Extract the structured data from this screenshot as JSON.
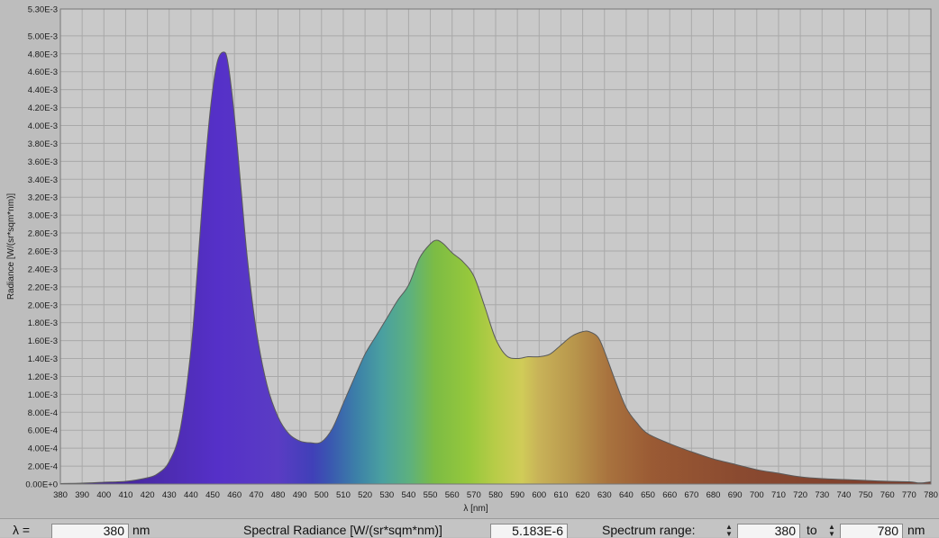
{
  "chart_data": {
    "type": "area",
    "xlabel": "λ [nm]",
    "ylabel": "Radiance [W/(sr*sqm*nm)]",
    "xlim": [
      380,
      780
    ],
    "ylim": [
      0,
      0.0053
    ],
    "grid": true,
    "x_ticks": [
      "380",
      "390",
      "400",
      "410",
      "420",
      "430",
      "440",
      "450",
      "460",
      "470",
      "480",
      "490",
      "500",
      "510",
      "520",
      "530",
      "540",
      "550",
      "560",
      "570",
      "580",
      "590",
      "600",
      "610",
      "620",
      "630",
      "640",
      "650",
      "660",
      "670",
      "680",
      "690",
      "700",
      "710",
      "720",
      "730",
      "740",
      "750",
      "760",
      "770",
      "780"
    ],
    "y_ticks": [
      "0.00E+0",
      "2.00E-4",
      "4.00E-4",
      "6.00E-4",
      "8.00E-4",
      "1.00E-3",
      "1.20E-3",
      "1.40E-3",
      "1.60E-3",
      "1.80E-3",
      "2.00E-3",
      "2.20E-3",
      "2.40E-3",
      "2.60E-3",
      "2.80E-3",
      "3.00E-3",
      "3.20E-3",
      "3.40E-3",
      "3.60E-3",
      "3.80E-3",
      "4.00E-3",
      "4.20E-3",
      "4.40E-3",
      "4.60E-3",
      "4.80E-3",
      "5.00E-3",
      "5.30E-3"
    ],
    "x": [
      380,
      390,
      400,
      410,
      420,
      425,
      430,
      435,
      440,
      443,
      446,
      449,
      452,
      455,
      457,
      460,
      463,
      466,
      470,
      475,
      480,
      485,
      490,
      495,
      500,
      505,
      510,
      515,
      520,
      525,
      530,
      535,
      540,
      545,
      550,
      553,
      556,
      560,
      565,
      570,
      575,
      580,
      585,
      590,
      595,
      600,
      605,
      610,
      615,
      620,
      623,
      627,
      630,
      635,
      640,
      645,
      650,
      660,
      670,
      680,
      690,
      700,
      710,
      720,
      730,
      740,
      750,
      760,
      770,
      775,
      780
    ],
    "y": [
      5e-06,
      1e-05,
      2e-05,
      3e-05,
      7e-05,
      0.00012,
      0.00025,
      0.0006,
      0.0015,
      0.0024,
      0.0034,
      0.0042,
      0.0047,
      0.00482,
      0.0047,
      0.0041,
      0.0033,
      0.0025,
      0.00172,
      0.0011,
      0.00075,
      0.00056,
      0.00048,
      0.00046,
      0.00047,
      0.00062,
      0.0009,
      0.00118,
      0.00145,
      0.00165,
      0.00185,
      0.00205,
      0.00222,
      0.00252,
      0.00268,
      0.00272,
      0.00268,
      0.00258,
      0.00248,
      0.00232,
      0.00198,
      0.00162,
      0.00143,
      0.0014,
      0.00142,
      0.00142,
      0.00145,
      0.00155,
      0.00165,
      0.0017,
      0.0017,
      0.00164,
      0.00148,
      0.00115,
      0.00085,
      0.00068,
      0.00056,
      0.00045,
      0.00036,
      0.00028,
      0.00022,
      0.00016,
      0.00012,
      8e-05,
      6e-05,
      5e-05,
      4e-05,
      3e-05,
      2.5e-05,
      1.2e-05,
      2.5e-05
    ]
  },
  "bottom_bar": {
    "lambda_label": "λ =",
    "lambda_value": "380",
    "lambda_unit": "nm",
    "radiance_label": "Spectral Radiance [W/(sr*sqm*nm)]",
    "radiance_value": "5.183E-6",
    "range_label": "Spectrum range:",
    "range_from": "380",
    "range_to_label": "to",
    "range_to": "780",
    "range_unit": "nm"
  }
}
